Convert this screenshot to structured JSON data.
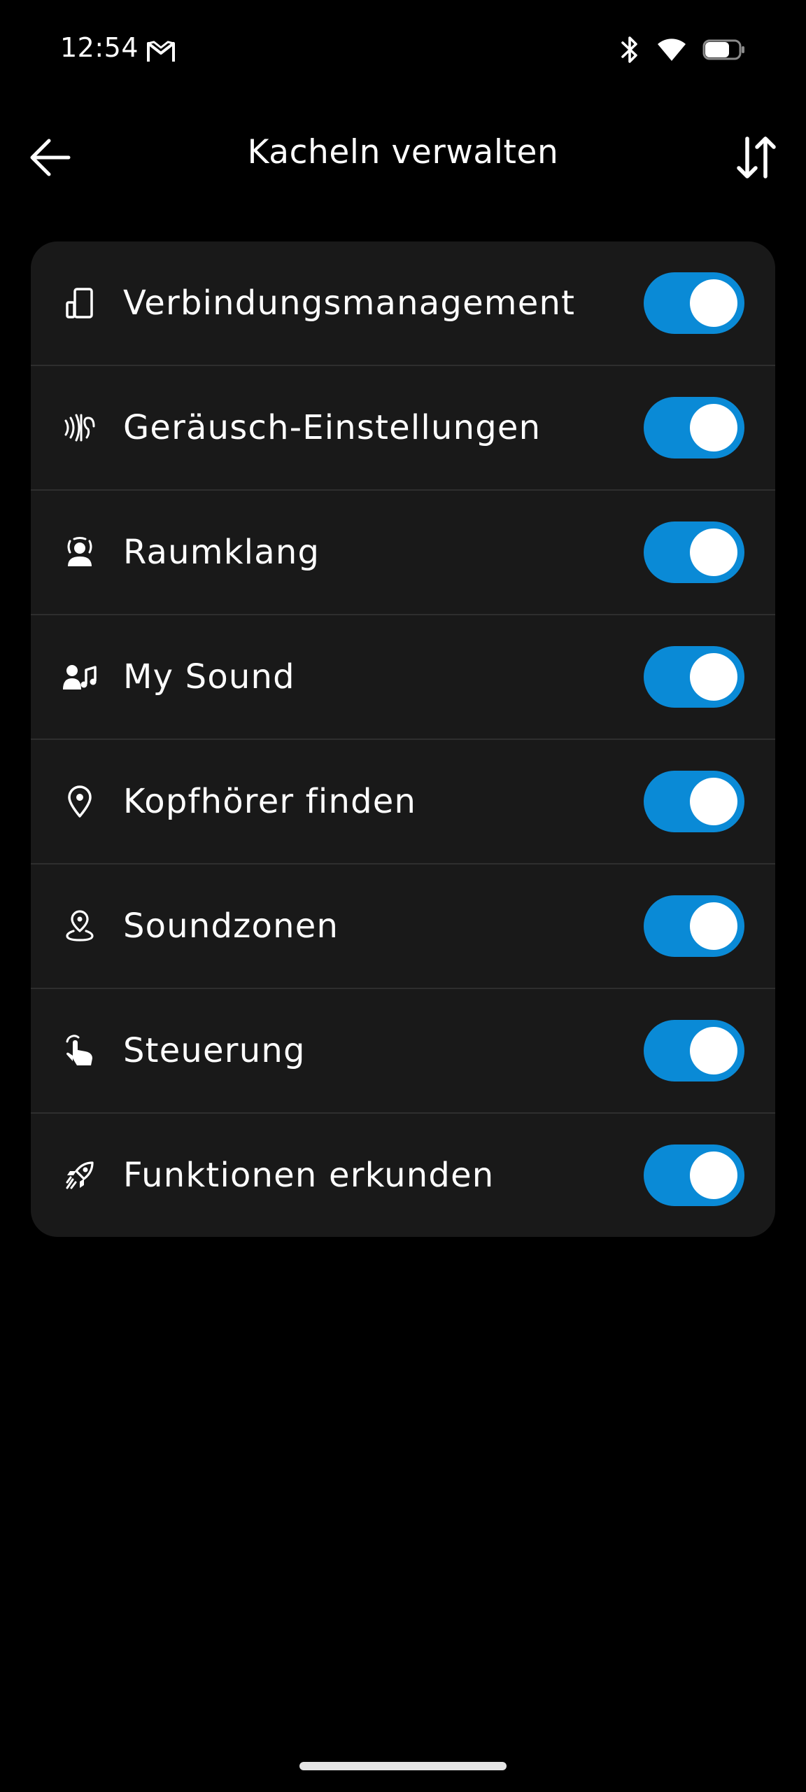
{
  "status_bar": {
    "time": "12:54",
    "notification_icon": "gmail-icon",
    "icons": [
      "bluetooth-icon",
      "wifi-icon",
      "battery-icon"
    ]
  },
  "app_bar": {
    "title": "Kacheln verwalten",
    "back_icon": "arrow-left-icon",
    "sort_icon": "sort-icon"
  },
  "tiles": [
    {
      "label": "Verbindungsmanagement",
      "icon": "devices-icon",
      "enabled": true
    },
    {
      "label": "Geräusch-Einstellungen",
      "icon": "noise-settings-icon",
      "enabled": true
    },
    {
      "label": "Raumklang",
      "icon": "spatial-sound-icon",
      "enabled": true
    },
    {
      "label": "My Sound",
      "icon": "my-sound-icon",
      "enabled": true
    },
    {
      "label": "Kopfhörer finden",
      "icon": "location-pin-icon",
      "enabled": true
    },
    {
      "label": "Soundzonen",
      "icon": "sound-zone-icon",
      "enabled": true
    },
    {
      "label": "Steuerung",
      "icon": "touch-gesture-icon",
      "enabled": true
    },
    {
      "label": "Funktionen erkunden",
      "icon": "rocket-icon",
      "enabled": true
    }
  ],
  "colors": {
    "background": "#000000",
    "card": "#191919",
    "toggle_on": "#0a8ad6",
    "text": "#ffffff"
  }
}
